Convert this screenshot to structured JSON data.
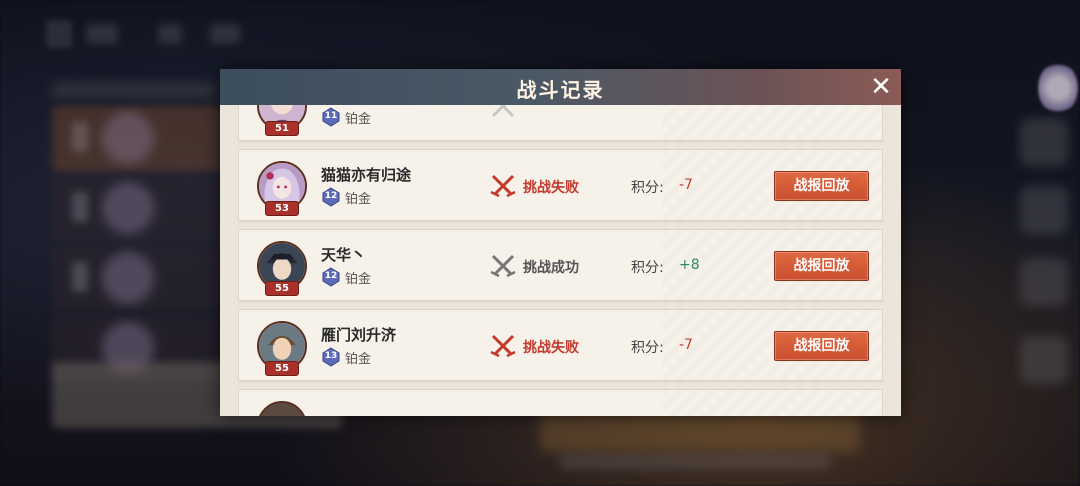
{
  "dialog": {
    "title": "战斗记录",
    "close_label": "✕"
  },
  "records": [
    {
      "name": "",
      "level": "51",
      "rank_num": "11",
      "rank": "铂金",
      "result": "",
      "score_label": "",
      "score": "",
      "replay_label": "",
      "partial": "top"
    },
    {
      "name": "猫猫亦有归途",
      "level": "53",
      "rank_num": "12",
      "rank": "铂金",
      "result": "挑战失败",
      "result_type": "lose",
      "score_label": "积分:",
      "score": "-7",
      "replay_label": "战报回放"
    },
    {
      "name": "天华丶",
      "level": "55",
      "rank_num": "12",
      "rank": "铂金",
      "result": "挑战成功",
      "result_type": "win",
      "score_label": "积分:",
      "score": "+8",
      "replay_label": "战报回放"
    },
    {
      "name": "雁门刘升济",
      "level": "55",
      "rank_num": "13",
      "rank": "铂金",
      "result": "挑战失败",
      "result_type": "lose",
      "score_label": "积分:",
      "score": "-7",
      "replay_label": "战报回放"
    }
  ],
  "colors": {
    "lose": "#c23a2e",
    "win": "#2d8a6e",
    "replay_button": "#d95a37",
    "header_left": "#3c4d5c",
    "header_right": "#8c5b55"
  }
}
